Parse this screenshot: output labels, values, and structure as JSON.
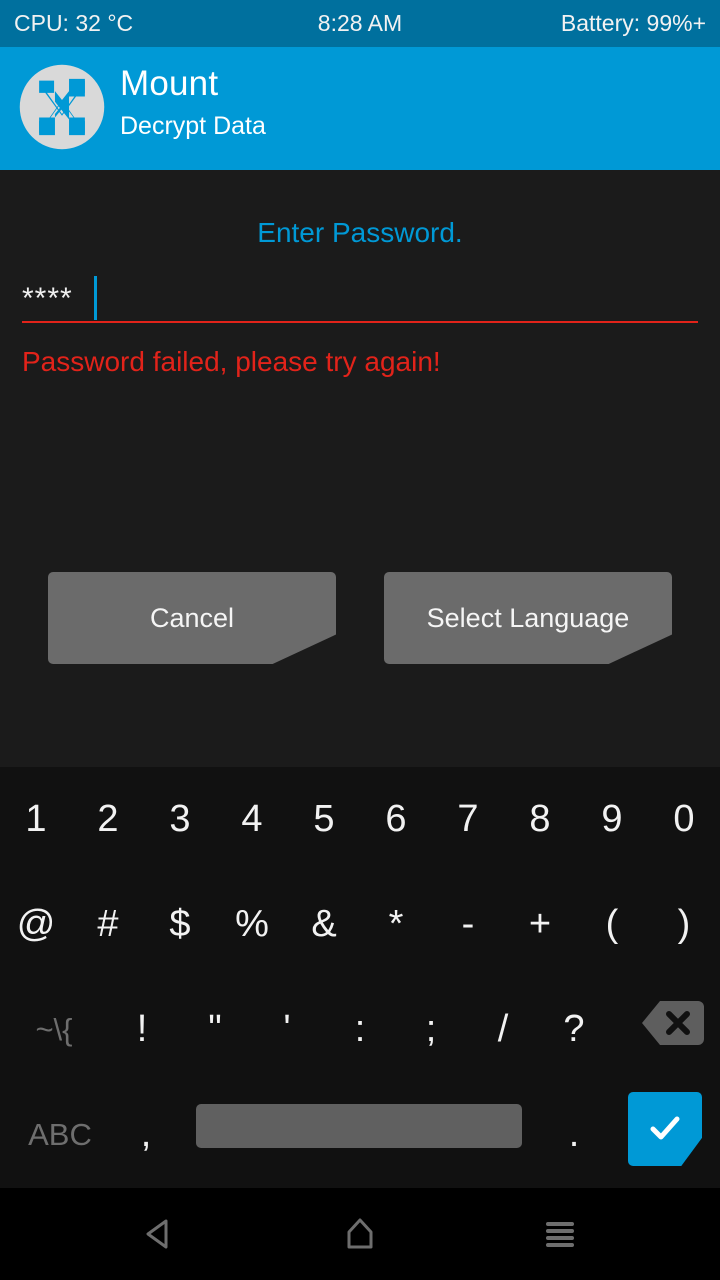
{
  "status_bar": {
    "cpu": "CPU: 32 °C",
    "time": "8:28 AM",
    "battery": "Battery: 99%+"
  },
  "header": {
    "title": "Mount",
    "subtitle": "Decrypt Data",
    "logo_icon": "twrp-logo-icon",
    "background_color": "#0099d6",
    "status_background_color": "#00709e"
  },
  "main": {
    "prompt": "Enter Password.",
    "password_value": "****",
    "password_placeholder": "",
    "error_message": "Password failed, please try again!",
    "accent_color": "#0099d6",
    "error_color": "#e2231a",
    "buttons": [
      {
        "label": "Cancel",
        "name": "cancel-button"
      },
      {
        "label": "Select Language",
        "name": "select-language-button"
      }
    ]
  },
  "keyboard": {
    "row1": [
      "1",
      "2",
      "3",
      "4",
      "5",
      "6",
      "7",
      "8",
      "9",
      "0"
    ],
    "row2": [
      "@",
      "#",
      "$",
      "%",
      "&",
      "*",
      "-",
      "+",
      "(",
      ")"
    ],
    "row3_shift": "~\\{",
    "row3": [
      "!",
      "\"",
      "'",
      ":",
      ";",
      "/",
      "?"
    ],
    "row3_backspace_icon": "backspace-icon",
    "row4": {
      "abc": "ABC",
      "comma": ",",
      "space": "",
      "period": ".",
      "enter_icon": "check-icon"
    },
    "background_color": "#111111",
    "enter_color": "#0099d6"
  },
  "navbar": {
    "back_icon": "back-triangle-icon",
    "home_icon": "home-icon",
    "recent_icon": "menu-icon"
  }
}
